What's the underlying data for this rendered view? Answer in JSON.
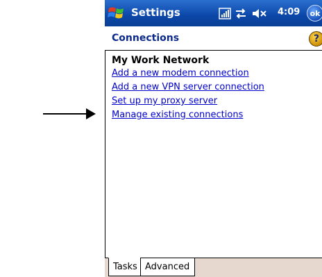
{
  "titlebar": {
    "app_title": "Settings",
    "clock": "4:09",
    "ok_label": "ok"
  },
  "header": {
    "page_title": "Connections",
    "help_label": "?"
  },
  "content": {
    "section_title": "My Work Network",
    "links": [
      "Add a new modem connection",
      "Add a new VPN server connection",
      "Set up my proxy server",
      "Manage existing connections"
    ]
  },
  "tabs": [
    {
      "label": "Tasks",
      "selected": true
    },
    {
      "label": "Advanced",
      "selected": false
    }
  ],
  "icons": {
    "start": "windows-flag-icon",
    "signal": "signal-strength-icon",
    "connectivity": "connectivity-arrows-icon",
    "volume": "volume-muted-icon",
    "help": "help-icon"
  },
  "colors": {
    "titlebar": "#0b47a8",
    "link": "#0000cc",
    "page_title": "#0c2a8c",
    "tabbar": "#e7d8cf"
  }
}
